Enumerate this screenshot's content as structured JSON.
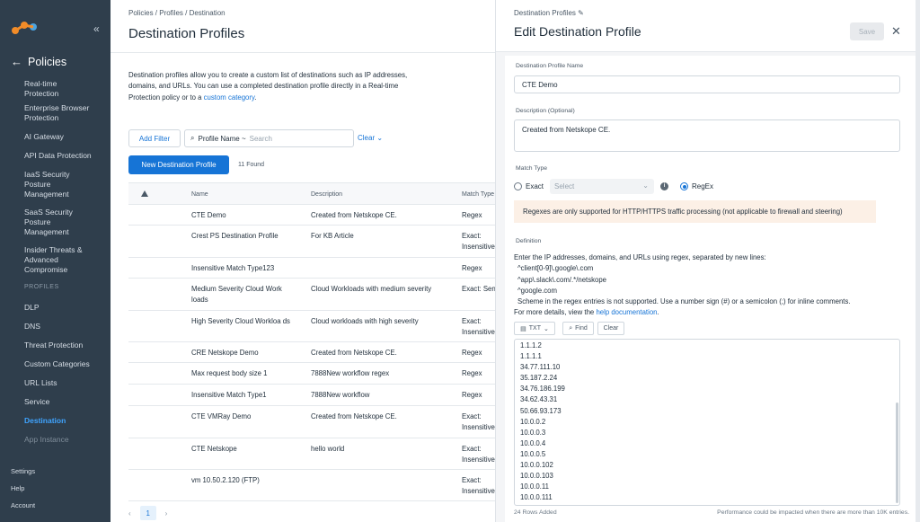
{
  "sidebar": {
    "title": "Policies",
    "items": [
      {
        "label": "Real-time Protection"
      },
      {
        "label": "Enterprise Browser Protection"
      },
      {
        "label": "AI Gateway"
      },
      {
        "label": "API Data Protection"
      },
      {
        "label": "IaaS Security Posture Management"
      },
      {
        "label": "SaaS Security Posture Management"
      },
      {
        "label": "Insider Threats & Advanced Compromise"
      }
    ],
    "section_label": "PROFILES",
    "profiles": [
      {
        "label": "DLP"
      },
      {
        "label": "DNS"
      },
      {
        "label": "Threat Protection"
      },
      {
        "label": "Custom Categories"
      },
      {
        "label": "URL Lists"
      },
      {
        "label": "Service"
      },
      {
        "label": "Destination"
      },
      {
        "label": "App Instance"
      }
    ],
    "bottom": {
      "settings": "Settings",
      "help": "Help",
      "account": "Account"
    }
  },
  "main": {
    "breadcrumb": "Policies / Profiles / Destination",
    "title": "Destination Profiles",
    "intro_text": "Destination profiles allow you to create a custom list of destinations such as IP addresses, domains, and URLs. You can use a completed destination profile directly in a Real-time Protection policy or to a",
    "intro_link": "custom category",
    "intro_end": ".",
    "add_filter": "Add Filter",
    "search_field": "Profile Name ~",
    "search_placeholder": "Search",
    "clear": "Clear",
    "new_button": "New Destination Profile",
    "found": "11 Found",
    "columns": {
      "name": "Name",
      "description": "Description",
      "match_type": "Match Type"
    },
    "rows": [
      {
        "name": "CTE Demo",
        "description": "Created from Netskope CE.",
        "type": "Regex"
      },
      {
        "name": "Crest PS Destination Profile",
        "description": "For KB Article",
        "type": "Exact: Insensitive"
      },
      {
        "name": "Insensitive Match Type123",
        "description": "",
        "type": "Regex"
      },
      {
        "name": "Medium Severity Cloud Work loads",
        "description": "Cloud Workloads with medium severity",
        "type": "Exact: Sensitive"
      },
      {
        "name": "High Severity Cloud Workloa ds",
        "description": "Cloud workloads with high severity",
        "type": "Exact: Insensitive"
      },
      {
        "name": "CRE Netskope Demo",
        "description": "Created from Netskope CE.",
        "type": "Regex"
      },
      {
        "name": "Max request body size 1",
        "description": "7888New workflow regex",
        "type": "Regex"
      },
      {
        "name": "Insensitive Match Type1",
        "description": "7888New workflow",
        "type": "Regex"
      },
      {
        "name": "CTE VMRay Demo",
        "description": "Created from Netskope CE.",
        "type": "Exact: Insensitive"
      },
      {
        "name": "CTE Netskope",
        "description": "hello world",
        "type": "Exact: Insensitive"
      },
      {
        "name": "vm 10.50.2.120 (FTP)",
        "description": "",
        "type": "Exact: Insensitive"
      }
    ],
    "page": "1"
  },
  "panel": {
    "breadcrumb": "Destination Profiles",
    "title": "Edit Destination Profile",
    "save": "Save",
    "name_label": "Destination Profile Name",
    "name_value": "CTE Demo",
    "desc_label": "Description (Optional)",
    "desc_value": "Created from Netskope CE.",
    "match_label": "Match Type",
    "exact_label": "Exact",
    "select_placeholder": "Select",
    "regex_label": "RegEx",
    "warning": "Regexes are only supported for HTTP/HTTPS traffic processing (not applicable to firewall and steering)",
    "definition_label": "Definition",
    "def_line1": "Enter the IP addresses, domains, and URLs using regex, separated by new lines:",
    "def_ex1": "^client[0-9]\\.google\\.com",
    "def_ex2": "^app\\.slack\\.com/.*/netskope",
    "def_ex3": "^google.com",
    "def_line2": "Scheme in the regex entries is not supported. Use a number sign (#) or a semicolon (;) for inline comments.",
    "def_line3_pre": "For more details, view the",
    "def_link": "help documentation",
    "def_line3_post": ".",
    "format": "TXT",
    "find": "Find",
    "clear": "Clear",
    "entries": [
      "1.1.1.2",
      "1.1.1.1",
      "34.77.111.10",
      "35.187.2.24",
      "34.76.186.199",
      "34.62.43.31",
      "50.66.93.173",
      "10.0.0.2",
      "10.0.0.3",
      "10.0.0.4",
      "10.0.0.5",
      "10.0.0.102",
      "10.0.0.103",
      "10.0.0.11",
      "10.0.0.111"
    ],
    "rows_added": "24 Rows Added",
    "perf_note": "Performance could be impacted when there are more than 10K entries."
  },
  "colors": {
    "sidebar": "#2f3e4c",
    "accent": "#1674d6",
    "active": "#3fa4ff",
    "warning_bg": "#fcf0e6"
  }
}
